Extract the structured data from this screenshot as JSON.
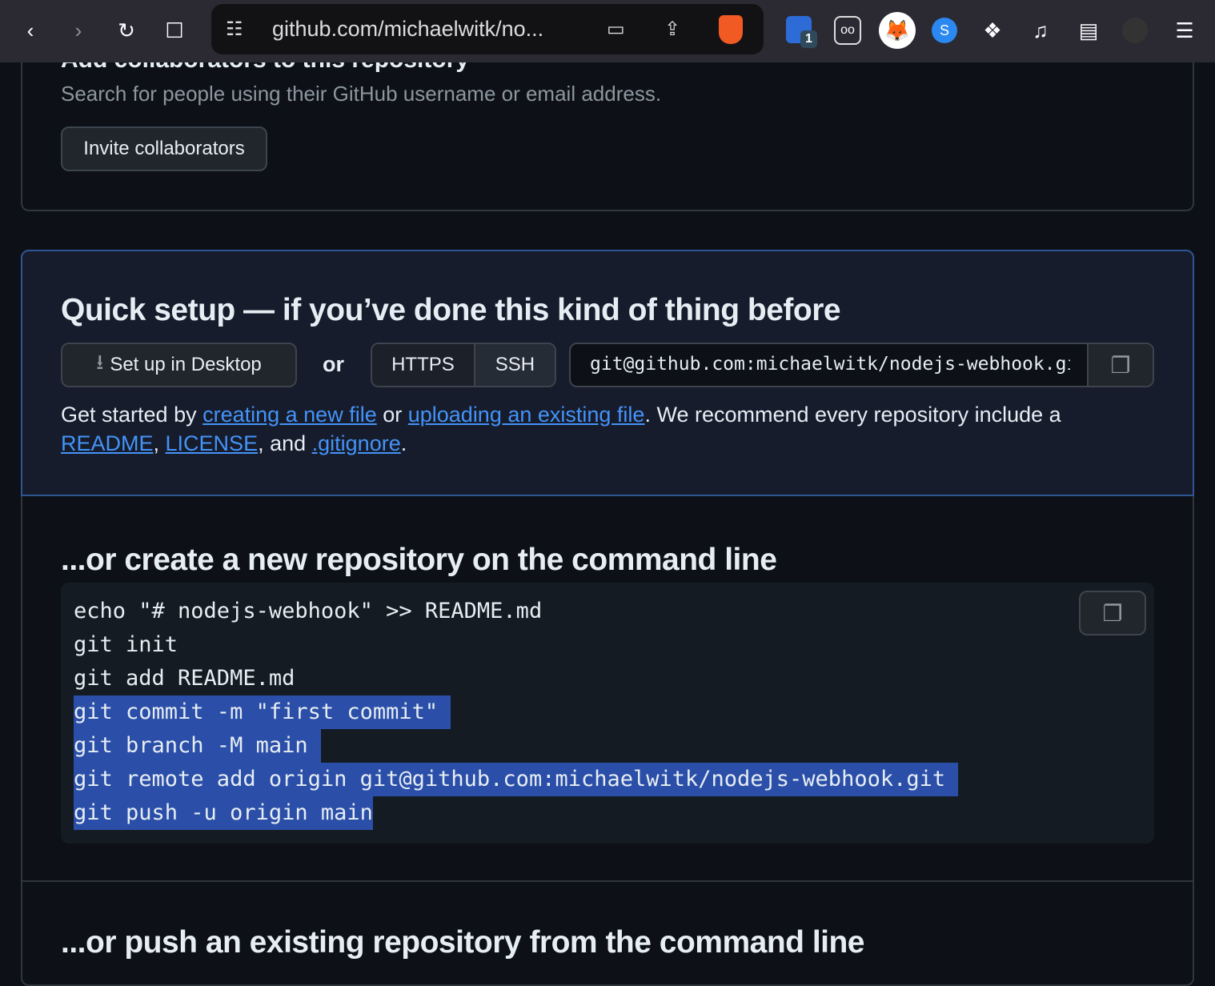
{
  "browser": {
    "url": "github.com/michaelwitk/no...",
    "extension_badge": "1"
  },
  "collaborators": {
    "title": "Add collaborators to this repository",
    "subtitle": "Search for people using their GitHub username or email address.",
    "invite_label": "Invite collaborators"
  },
  "quick_setup": {
    "title": "Quick setup — if you’ve done this kind of thing before",
    "desktop_label": "Set up in Desktop",
    "or": "or",
    "https": "HTTPS",
    "ssh": "SSH",
    "clone_url": "git@github.com:michaelwitk/nodejs-webhook.git",
    "p1": "Get started by ",
    "link_new": "creating a new file",
    "p2": " or ",
    "link_upload": "uploading an existing file",
    "p3": ". We recommend every repository include a ",
    "link_readme": "README",
    "p4": ", ",
    "link_license": "LICENSE",
    "p5": ", and ",
    "link_gitignore": ".gitignore",
    "p6": "."
  },
  "cli": {
    "title": "...or create a new repository on the command line",
    "lines": [
      "echo \"# nodejs-webhook\" >> README.md",
      "git init",
      "git add README.md",
      "git commit -m \"first commit\" ",
      "git branch -M main ",
      "git remote add origin git@github.com:michaelwitk/nodejs-webhook.git ",
      "git push -u origin main"
    ]
  },
  "push": {
    "title": "...or push an existing repository from the command line"
  }
}
